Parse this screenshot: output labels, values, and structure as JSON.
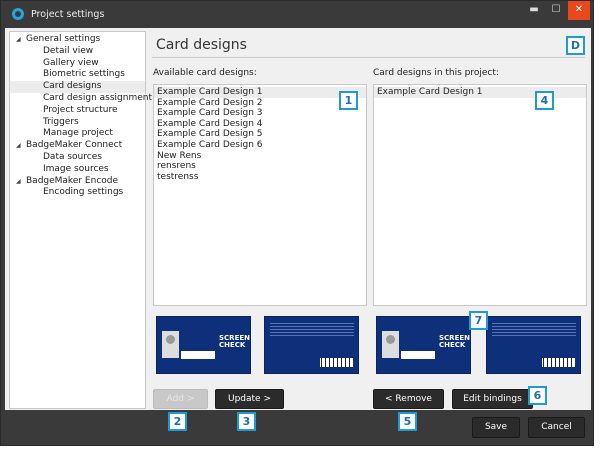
{
  "window": {
    "title": "Project settings",
    "minimize": "▬",
    "maximize": "☐",
    "close": "✕"
  },
  "tree": [
    {
      "label": "General settings",
      "level": 0
    },
    {
      "label": "Detail view",
      "level": 1
    },
    {
      "label": "Gallery view",
      "level": 1
    },
    {
      "label": "Biometric settings",
      "level": 1
    },
    {
      "label": "Card designs",
      "level": 1,
      "selected": true
    },
    {
      "label": "Card design assignment",
      "level": 1
    },
    {
      "label": "Project structure",
      "level": 1
    },
    {
      "label": "Triggers",
      "level": 1
    },
    {
      "label": "Manage project",
      "level": 1
    },
    {
      "label": "BadgeMaker Connect",
      "level": 0
    },
    {
      "label": "Data sources",
      "level": 1
    },
    {
      "label": "Image sources",
      "level": 1
    },
    {
      "label": "BadgeMaker Encode",
      "level": 0
    },
    {
      "label": "Encoding settings",
      "level": 1
    }
  ],
  "main": {
    "heading": "Card designs",
    "available_label": "Available card designs:",
    "available": [
      "Example Card Design 1",
      "Example Card Design 2",
      "Example Card Design 3",
      "Example Card Design 4",
      "Example Card Design 5",
      "Example Card Design 6",
      "New Rens",
      "rensrens",
      "testrenss"
    ],
    "project_label": "Card designs in this project:",
    "project": [
      "Example Card Design 1"
    ],
    "buttons": {
      "add": "Add >",
      "update": "Update >",
      "remove": "< Remove",
      "edit": "Edit bindings"
    },
    "card_logo": "SCREEN CHECK"
  },
  "footer": {
    "save": "Save",
    "cancel": "Cancel"
  },
  "badges": {
    "d": "D",
    "b1": "1",
    "b2": "2",
    "b3": "3",
    "b4": "4",
    "b5": "5",
    "b6": "6",
    "b7": "7"
  },
  "colors": {
    "accent": "#1e9ad6",
    "close": "#e8481c",
    "card": "#0e2f7a"
  }
}
